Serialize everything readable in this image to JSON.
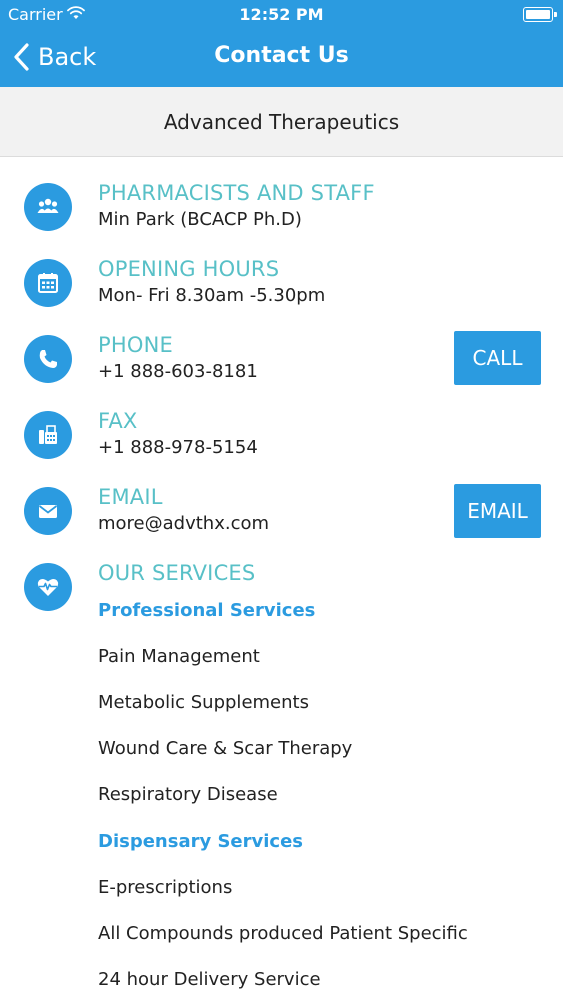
{
  "status_bar": {
    "carrier": "Carrier",
    "time": "12:52 PM"
  },
  "nav": {
    "back_label": "Back",
    "title": "Contact Us"
  },
  "subheader": {
    "title": "Advanced Therapeutics"
  },
  "sections": {
    "staff": {
      "title": "PHARMACISTS AND STAFF",
      "value": "Min Park (BCACP Ph.D)",
      "icon": "people-icon"
    },
    "hours": {
      "title": "OPENING HOURS",
      "value": "Mon- Fri 8.30am -5.30pm",
      "icon": "calendar-icon"
    },
    "phone": {
      "title": "PHONE",
      "value": "+1 888-603-8181",
      "icon": "phone-icon",
      "button": "CALL"
    },
    "fax": {
      "title": "FAX",
      "value": "+1 888-978-5154",
      "icon": "fax-icon"
    },
    "email": {
      "title": "EMAIL",
      "value": "more@advthx.com",
      "icon": "envelope-icon",
      "button": "EMAIL"
    },
    "services": {
      "title": "OUR SERVICES",
      "icon": "heart-pulse-icon",
      "groups": [
        {
          "heading": "Professional Services",
          "items": [
            "Pain Management",
            "Metabolic Supplements",
            "Wound Care & Scar Therapy",
            "Respiratory Disease"
          ]
        },
        {
          "heading": "Dispensary Services",
          "items": [
            "E-prescriptions",
            "All Compounds produced Patient Specific",
            "24 hour Delivery Service"
          ]
        }
      ]
    }
  },
  "colors": {
    "primary": "#2b9be0",
    "section_title": "#58c0c7",
    "subheader_bg": "#f2f2f2"
  }
}
